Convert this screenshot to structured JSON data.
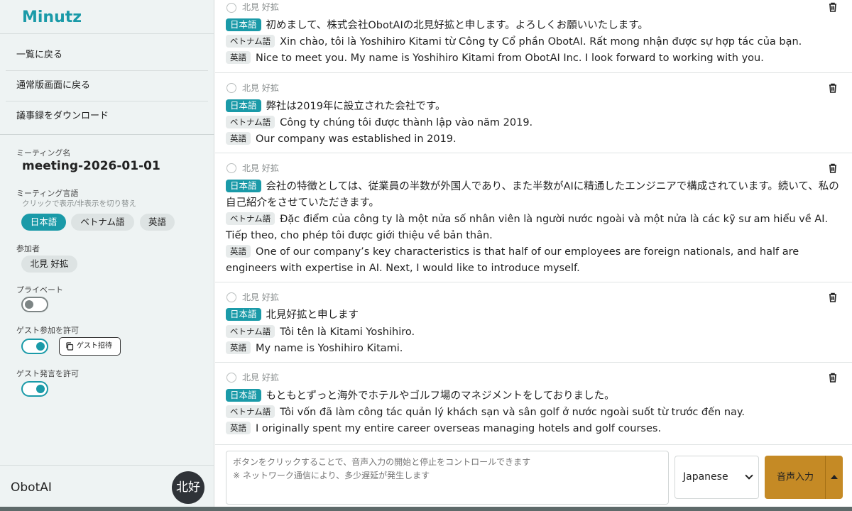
{
  "sidebar": {
    "brand": "Minutz",
    "nav": [
      {
        "label": "一覧に戻る"
      },
      {
        "label": "通常版画面に戻る"
      },
      {
        "label": "議事録をダウンロード"
      }
    ],
    "meeting_name_label": "ミーティング名",
    "meeting_name": "meeting-2026-01-01",
    "meeting_lang_label": "ミーティング言語",
    "meeting_lang_hint": "クリックで表示/非表示を切り替え",
    "languages": [
      {
        "label": "日本語",
        "active": true
      },
      {
        "label": "ベトナム語",
        "active": false
      },
      {
        "label": "英語",
        "active": false
      }
    ],
    "participants_label": "参加者",
    "participants": [
      "北見 好拡"
    ],
    "private_label": "プライベート",
    "private_on": false,
    "guest_join_label": "ゲスト参加を許可",
    "guest_join_on": true,
    "guest_invite_label": "ゲスト招待",
    "guest_speak_label": "ゲスト発言を許可",
    "guest_speak_on": true,
    "org_name": "ObotAI",
    "avatar_text": "北好"
  },
  "transcript": [
    {
      "speaker": "北見 好拡",
      "ja_tag": "日本語",
      "ja": "初めまして、株式会社ObotAIの北見好拡と申します。よろしくお願いいたします。",
      "vi_tag": "ベトナム語",
      "vi": "Xin chào, tôi là Yoshihiro Kitami từ Công ty Cổ phần ObotAI. Rất mong nhận được sự hợp tác của bạn.",
      "en_tag": "英語",
      "en": "Nice to meet you. My name is Yoshihiro Kitami from ObotAI Inc. I look forward to working with you."
    },
    {
      "speaker": "北見 好拡",
      "ja_tag": "日本語",
      "ja": "弊社は2019年に設立された会社です。",
      "vi_tag": "ベトナム語",
      "vi": "Công ty chúng tôi được thành lập vào năm 2019.",
      "en_tag": "英語",
      "en": "Our company was established in 2019."
    },
    {
      "speaker": "北見 好拡",
      "ja_tag": "日本語",
      "ja": "会社の特徴としては、従業員の半数が外国人であり、また半数がAIに精通したエンジニアで構成されています。続いて、私の自己紹介をさせていただきます。",
      "vi_tag": "ベトナム語",
      "vi": "Đặc điểm của công ty là một nửa số nhân viên là người nước ngoài và một nửa là các kỹ sư am hiểu về AI. Tiếp theo, cho phép tôi được giới thiệu về bản thân.",
      "en_tag": "英語",
      "en": "One of our company’s key characteristics is that half of our employees are foreign nationals, and half are engineers with expertise in AI. Next, I would like to introduce myself."
    },
    {
      "speaker": "北見 好拡",
      "ja_tag": "日本語",
      "ja": "北見好拡と申します",
      "vi_tag": "ベトナム語",
      "vi": "Tôi tên là Kitami Yoshihiro.",
      "en_tag": "英語",
      "en": "My name is Yoshihiro Kitami."
    },
    {
      "speaker": "北見 好拡",
      "ja_tag": "日本語",
      "ja": "もともとずっと海外でホテルやゴルフ場のマネジメントをしておりました。",
      "vi_tag": "ベトナム語",
      "vi": "Tôi vốn đã làm công tác quản lý khách sạn và sân golf ở nước ngoài suốt từ trước đến nay.",
      "en_tag": "英語",
      "en": "I originally spent my entire career overseas managing hotels and golf courses."
    }
  ],
  "input": {
    "placeholder": "ボタンをクリックすることで、音声入力の開始と停止をコントロールできます\n※ ネットワーク通信により、多少遅延が発生します",
    "language": "Japanese",
    "voice_button": "音声入力"
  },
  "colors": {
    "accent": "#1a9aa8",
    "voice_button": "#c58a25"
  }
}
